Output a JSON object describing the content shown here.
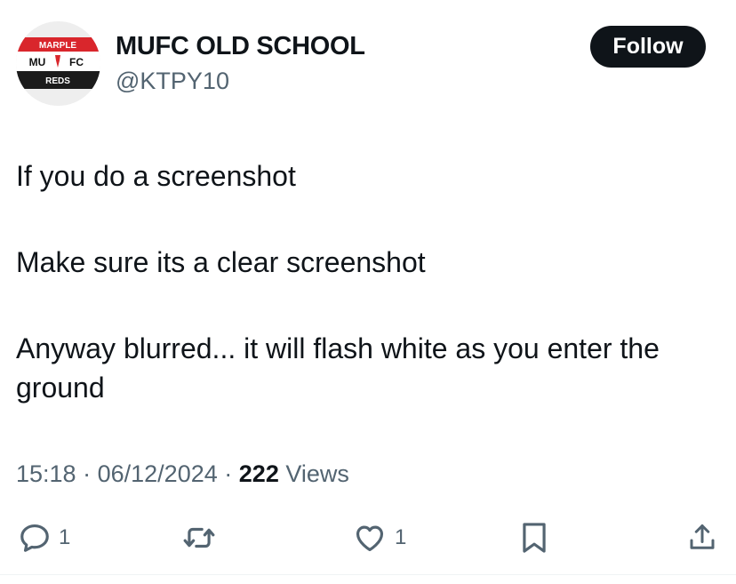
{
  "author": {
    "display_name": "MUFC OLD SCHOOL",
    "handle": "@KTPY10",
    "avatar_text": [
      "MARPLE",
      "MU",
      "FC",
      "REDS"
    ]
  },
  "follow_label": "Follow",
  "tweet": {
    "paragraphs": [
      "If you do a screenshot",
      "Make sure its a clear screenshot",
      "Anyway blurred... it will flash white as you enter the ground"
    ]
  },
  "meta": {
    "time": "15:18",
    "date": "06/12/2024",
    "separator": "·",
    "views_count": "222",
    "views_label": "Views"
  },
  "actions": {
    "replies": "1",
    "likes": "1"
  },
  "icons": [
    "reply-icon",
    "retweet-icon",
    "like-icon",
    "bookmark-icon",
    "share-icon"
  ]
}
